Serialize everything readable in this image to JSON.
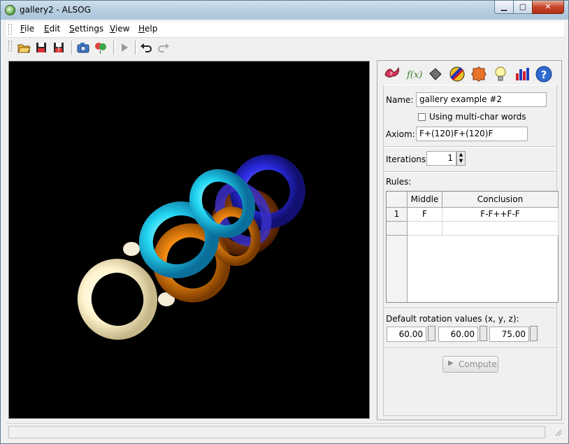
{
  "window": {
    "title": "gallery2 - ALSOG"
  },
  "menu": [
    {
      "label": "File",
      "accel": "F",
      "rest": "ile"
    },
    {
      "label": "Edit",
      "accel": "E",
      "rest": "dit"
    },
    {
      "label": "Settings",
      "accel": "S",
      "rest": "ettings"
    },
    {
      "label": "View",
      "accel": "V",
      "rest": "iew"
    },
    {
      "label": "Help",
      "accel": "H",
      "rest": "elp"
    }
  ],
  "toolbar": [
    "open-folder-icon",
    "save-icon",
    "save-as-icon",
    "camera-icon",
    "balloons-icon",
    "play-icon",
    "undo-icon",
    "redo-icon"
  ],
  "tabs": [
    "lsystem-tab-icon",
    "formula-tab-icon",
    "shape-tab-icon",
    "color-tab-icon",
    "puzzle-tab-icon",
    "light-bulb-icon",
    "chart-bars-icon",
    "help-circle-icon"
  ],
  "form": {
    "name_label": "Name:",
    "name_value": "gallery example #2",
    "multichar_label": "Using multi-char words",
    "multichar_checked": false,
    "axiom_label": "Axiom:",
    "axiom_value": "F+(120)F+(120)F",
    "iterations_label": "Iterations:",
    "iterations_value": "1",
    "rules_label": "Rules:",
    "rules": {
      "headers": [
        "Middle",
        "Conclusion"
      ],
      "rows": [
        {
          "num": "1",
          "middle": "F",
          "conclusion": "F-F++F-F"
        }
      ]
    },
    "rotation_label": "Default rotation values (x, y, z):",
    "rotation": [
      "60.00",
      "60.00",
      "75.00"
    ],
    "compute_label": "Compute"
  },
  "colors": {
    "viewport_bg": "#000000",
    "accent": "#3d6bb3"
  }
}
